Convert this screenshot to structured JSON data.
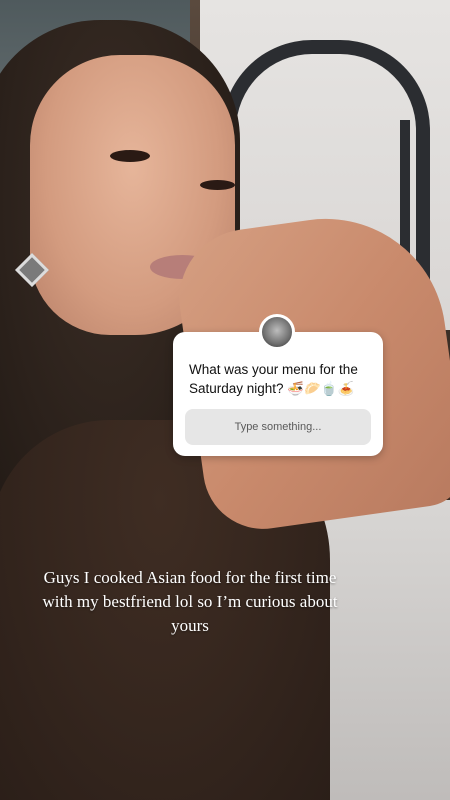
{
  "story": {
    "question_sticker": {
      "question": "What was your menu for the Saturday night? 🍜🥟🍵🍝",
      "input_placeholder": "Type something..."
    },
    "caption": "Guys I cooked Asian food for the first time with my bestfriend lol so I’m curious about yours"
  }
}
